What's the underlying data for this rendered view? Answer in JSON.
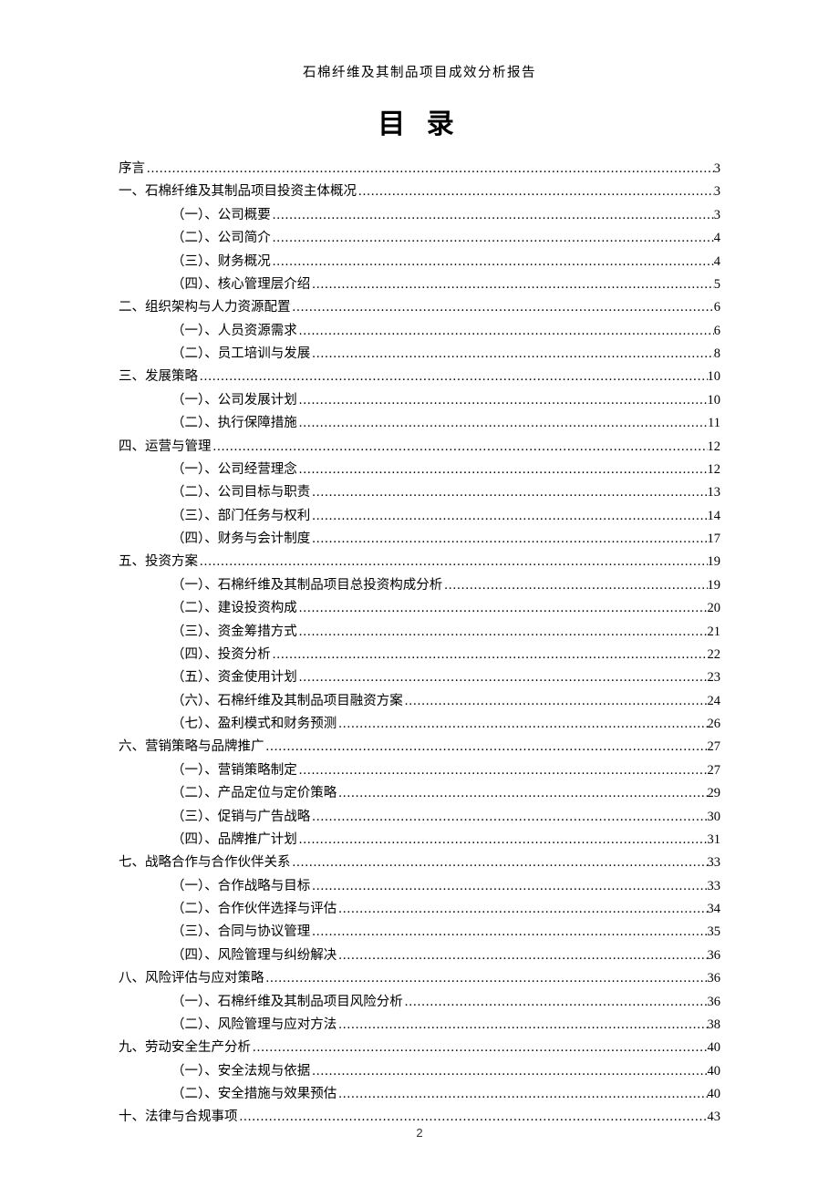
{
  "header": "石棉纤维及其制品项目成效分析报告",
  "title": "目 录",
  "pageNumber": "2",
  "toc": [
    {
      "level": 1,
      "label": "序言",
      "page": "3"
    },
    {
      "level": 1,
      "label": "一、石棉纤维及其制品项目投资主体概况",
      "page": "3"
    },
    {
      "level": 2,
      "label": "（一）、公司概要",
      "page": "3"
    },
    {
      "level": 2,
      "label": "（二）、公司简介",
      "page": "4"
    },
    {
      "level": 2,
      "label": "（三）、财务概况",
      "page": "4"
    },
    {
      "level": 2,
      "label": "（四）、核心管理层介绍",
      "page": "5"
    },
    {
      "level": 1,
      "label": "二、组织架构与人力资源配置",
      "page": "6"
    },
    {
      "level": 2,
      "label": "（一）、人员资源需求",
      "page": "6"
    },
    {
      "level": 2,
      "label": "（二）、员工培训与发展",
      "page": "8"
    },
    {
      "level": 1,
      "label": "三、发展策略",
      "page": "10"
    },
    {
      "level": 2,
      "label": "（一）、公司发展计划",
      "page": "10"
    },
    {
      "level": 2,
      "label": "（二）、执行保障措施",
      "page": "11"
    },
    {
      "level": 1,
      "label": "四、运营与管理",
      "page": "12"
    },
    {
      "level": 2,
      "label": "（一）、公司经营理念",
      "page": "12"
    },
    {
      "level": 2,
      "label": "（二）、公司目标与职责",
      "page": "13"
    },
    {
      "level": 2,
      "label": "（三）、部门任务与权利",
      "page": "14"
    },
    {
      "level": 2,
      "label": "（四）、财务与会计制度",
      "page": "17"
    },
    {
      "level": 1,
      "label": "五、投资方案",
      "page": "19"
    },
    {
      "level": 2,
      "label": "（一）、石棉纤维及其制品项目总投资构成分析",
      "page": "19"
    },
    {
      "level": 2,
      "label": "（二）、建设投资构成",
      "page": "20"
    },
    {
      "level": 2,
      "label": "（三）、资金筹措方式",
      "page": "21"
    },
    {
      "level": 2,
      "label": "（四）、投资分析",
      "page": "22"
    },
    {
      "level": 2,
      "label": "（五）、资金使用计划",
      "page": "23"
    },
    {
      "level": 2,
      "label": "（六）、石棉纤维及其制品项目融资方案",
      "page": "24"
    },
    {
      "level": 2,
      "label": "（七）、盈利模式和财务预测",
      "page": "26"
    },
    {
      "level": 1,
      "label": "六、营销策略与品牌推广",
      "page": "27"
    },
    {
      "level": 2,
      "label": "（一）、营销策略制定",
      "page": "27"
    },
    {
      "level": 2,
      "label": "（二）、产品定位与定价策略",
      "page": "29"
    },
    {
      "level": 2,
      "label": "（三）、促销与广告战略",
      "page": "30"
    },
    {
      "level": 2,
      "label": "（四）、品牌推广计划",
      "page": "31"
    },
    {
      "level": 1,
      "label": "七、战略合作与合作伙伴关系",
      "page": "33"
    },
    {
      "level": 2,
      "label": "（一）、合作战略与目标",
      "page": "33"
    },
    {
      "level": 2,
      "label": "（二）、合作伙伴选择与评估",
      "page": "34"
    },
    {
      "level": 2,
      "label": "（三）、合同与协议管理",
      "page": "35"
    },
    {
      "level": 2,
      "label": "（四）、风险管理与纠纷解决",
      "page": "36"
    },
    {
      "level": 1,
      "label": "八、风险评估与应对策略",
      "page": "36"
    },
    {
      "level": 2,
      "label": "（一）、石棉纤维及其制品项目风险分析",
      "page": "36"
    },
    {
      "level": 2,
      "label": "（二）、风险管理与应对方法",
      "page": "38"
    },
    {
      "level": 1,
      "label": "九、劳动安全生产分析",
      "page": "40"
    },
    {
      "level": 2,
      "label": "（一）、安全法规与依据",
      "page": "40"
    },
    {
      "level": 2,
      "label": "（二）、安全措施与效果预估",
      "page": "40"
    },
    {
      "level": 1,
      "label": "十、法律与合规事项",
      "page": "43"
    }
  ]
}
